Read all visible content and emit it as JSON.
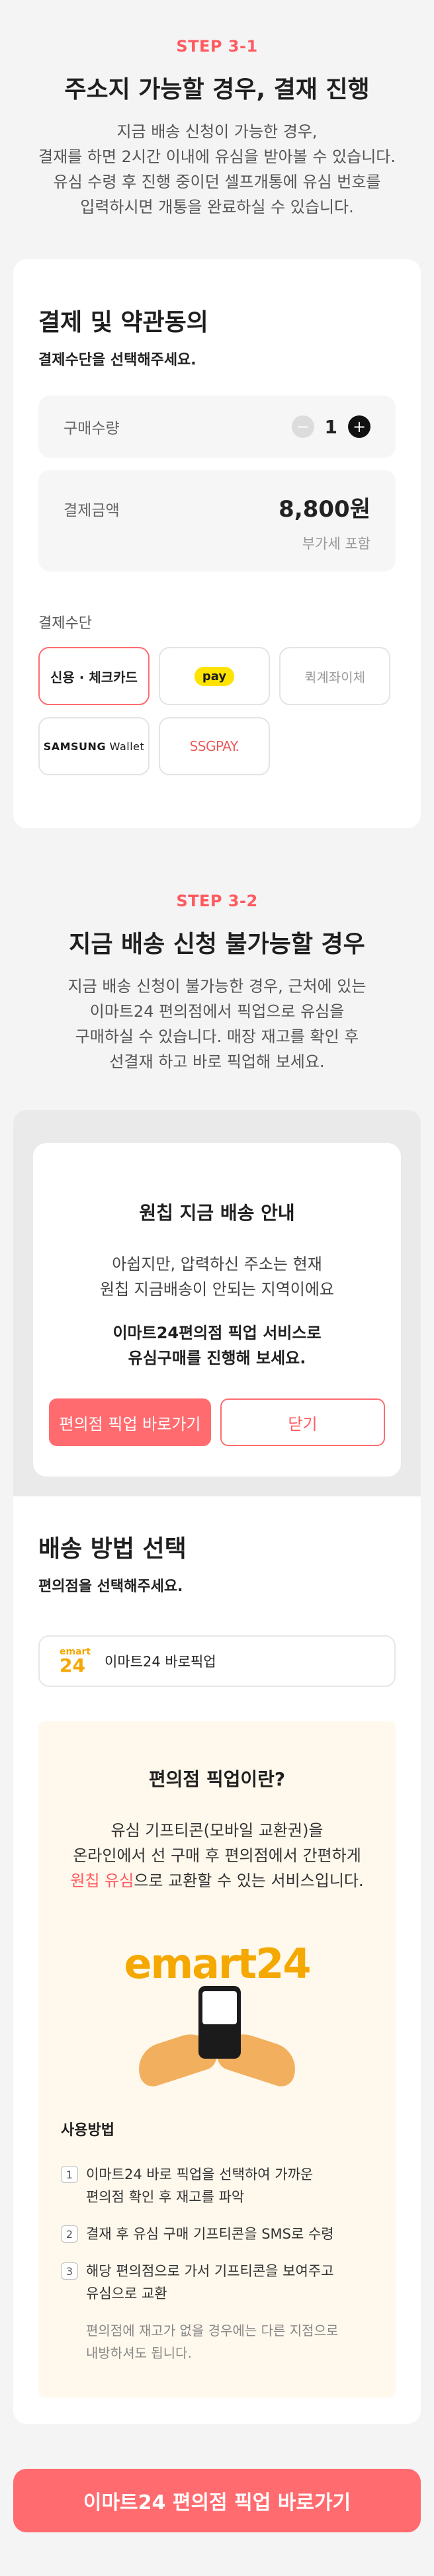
{
  "step1": {
    "label": "STEP 3-1",
    "title": "주소지 가능할 경우, 결재 진행",
    "desc": [
      "지금 배송 신청이 가능한 경우,",
      "결재를 하면 2시간 이내에 유심을 받아볼 수 있습니다.",
      "유심 수령 후 진행 중이던 셀프개통에 유심 번호를",
      "입력하시면 개통을 완료하실 수 있습니다."
    ]
  },
  "payment": {
    "title": "결제 및 약관동의",
    "subtitle": "결제수단을 선택해주세요.",
    "qty_label": "구매수량",
    "qty_value": "1",
    "minus": "−",
    "plus": "+",
    "amount_label": "결제금액",
    "amount_value": "8,800원",
    "vat_text": "부가세 포함",
    "method_label": "결제수단",
    "methods": {
      "card": "신용 · 체크카드",
      "kakaopay": "pay",
      "transfer": "퀵계좌이체",
      "samsung_bold": "SAMSUNG",
      "samsung_rest": " Wallet",
      "ssgpay": "SSGPAY."
    }
  },
  "step2": {
    "label": "STEP 3-2",
    "title": "지금 배송 신청 불가능할 경우",
    "desc": [
      "지금 배송 신청이 불가능한 경우, 근처에 있는",
      "이마트24 편의점에서 픽업으로 유심을",
      "구매하실 수 있습니다. 매장 재고를 확인 후",
      "선결재 하고 바로 픽업해 보세요."
    ]
  },
  "notice": {
    "title": "원칩 지금 배송 안내",
    "text": [
      "아쉽지만, 압력하신 주소는 현재",
      "원칩 지금배송이 안되는 지역이에요"
    ],
    "bold": [
      "이마트24편의점 픽업 서비스로",
      "유심구매를 진행해 보세요."
    ],
    "btn_primary": "편의점 픽업 바로가기",
    "btn_secondary": "닫기"
  },
  "shipping": {
    "title": "배송 방법 선택",
    "subtitle": "편의점을 선택해주세요.",
    "store_logo_top": "emart",
    "store_logo_bottom": "24",
    "store_name": "이마트24 바로픽업"
  },
  "info": {
    "title": "편의점 픽업이란?",
    "desc_line1": "유심 기프티콘(모바일 교환권)을",
    "desc_line2": "온라인에서 선 구매 후 편의점에서 간편하게",
    "desc_hl": "원칩 유심",
    "desc_tail": "으로 교환할 수 있는 서비스입니다.",
    "logo_text": "emart24",
    "usage_title": "사용방법",
    "steps": [
      {
        "num": "1",
        "lines": [
          "이마트24 바로 픽업을 선택하여 가까운",
          "편의점 확인 후 재고를 파악"
        ]
      },
      {
        "num": "2",
        "lines": [
          "결재 후 유심 구매 기프티콘을 SMS로 수령"
        ]
      },
      {
        "num": "3",
        "lines": [
          "해당 편의점으로 가서 기프티콘을 보여주고",
          "유심으로 교환"
        ]
      }
    ],
    "note": [
      "편의점에 재고가 없을 경우에는 다른 지점으로",
      "내방하셔도 됩니다."
    ]
  },
  "bottom_button": "이마트24 편의점 픽업 바로가기",
  "colors": {
    "accent": "#ff6b6f",
    "emart": "#f5a800",
    "kakao": "#ffe300"
  }
}
